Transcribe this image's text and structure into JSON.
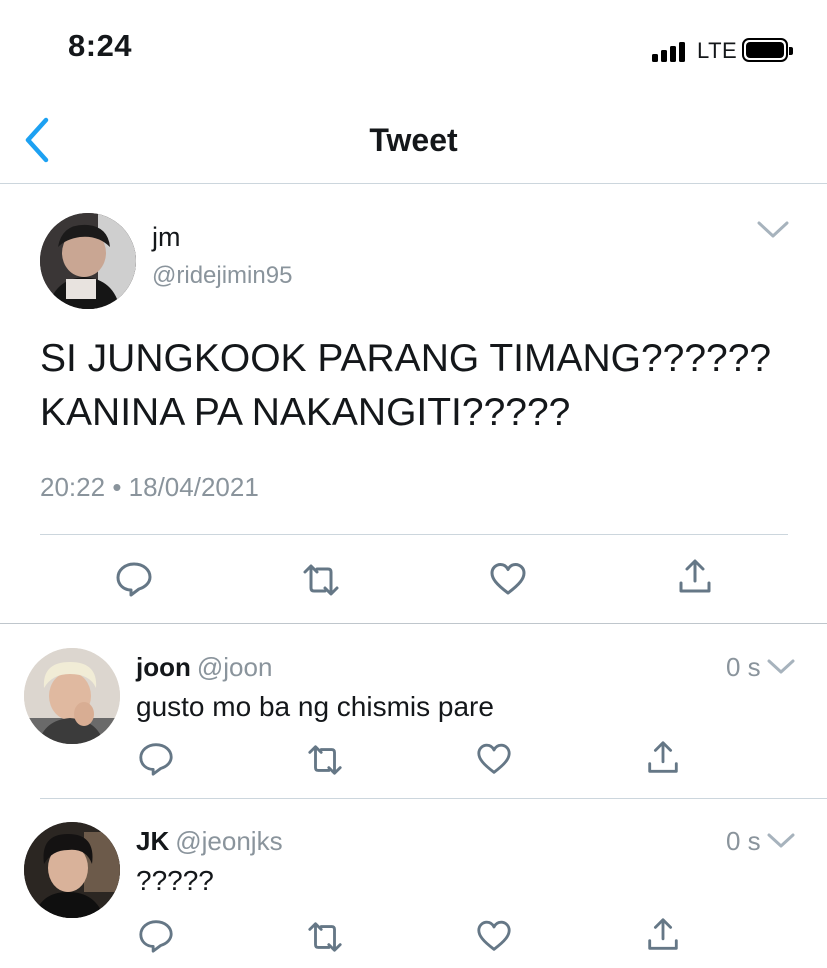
{
  "status_bar": {
    "time": "8:24",
    "network": "LTE"
  },
  "header": {
    "title": "Tweet",
    "back_icon": "chevron-left-icon"
  },
  "tweet": {
    "name": "jm",
    "handle": "@ridejimin95",
    "text": "SI JUNGKOOK PARANG TIMANG??????\nKANINA PA NAKANGITI?????",
    "time": "20:22",
    "separator": "•",
    "date": "18/04/2021",
    "actions": [
      "reply-icon",
      "retweet-icon",
      "like-icon",
      "share-icon"
    ]
  },
  "replies": [
    {
      "name": "joon",
      "handle": "@joon",
      "time": "0 s",
      "text": "gusto mo ba ng chismis pare"
    },
    {
      "name": "JK",
      "handle": "@jeonjks",
      "time": "0 s",
      "text": "?????"
    }
  ],
  "colors": {
    "accent": "#1da1f2",
    "icon_gray": "#657786",
    "secondary_text": "#8a949c",
    "divider": "#ccd6dd"
  }
}
